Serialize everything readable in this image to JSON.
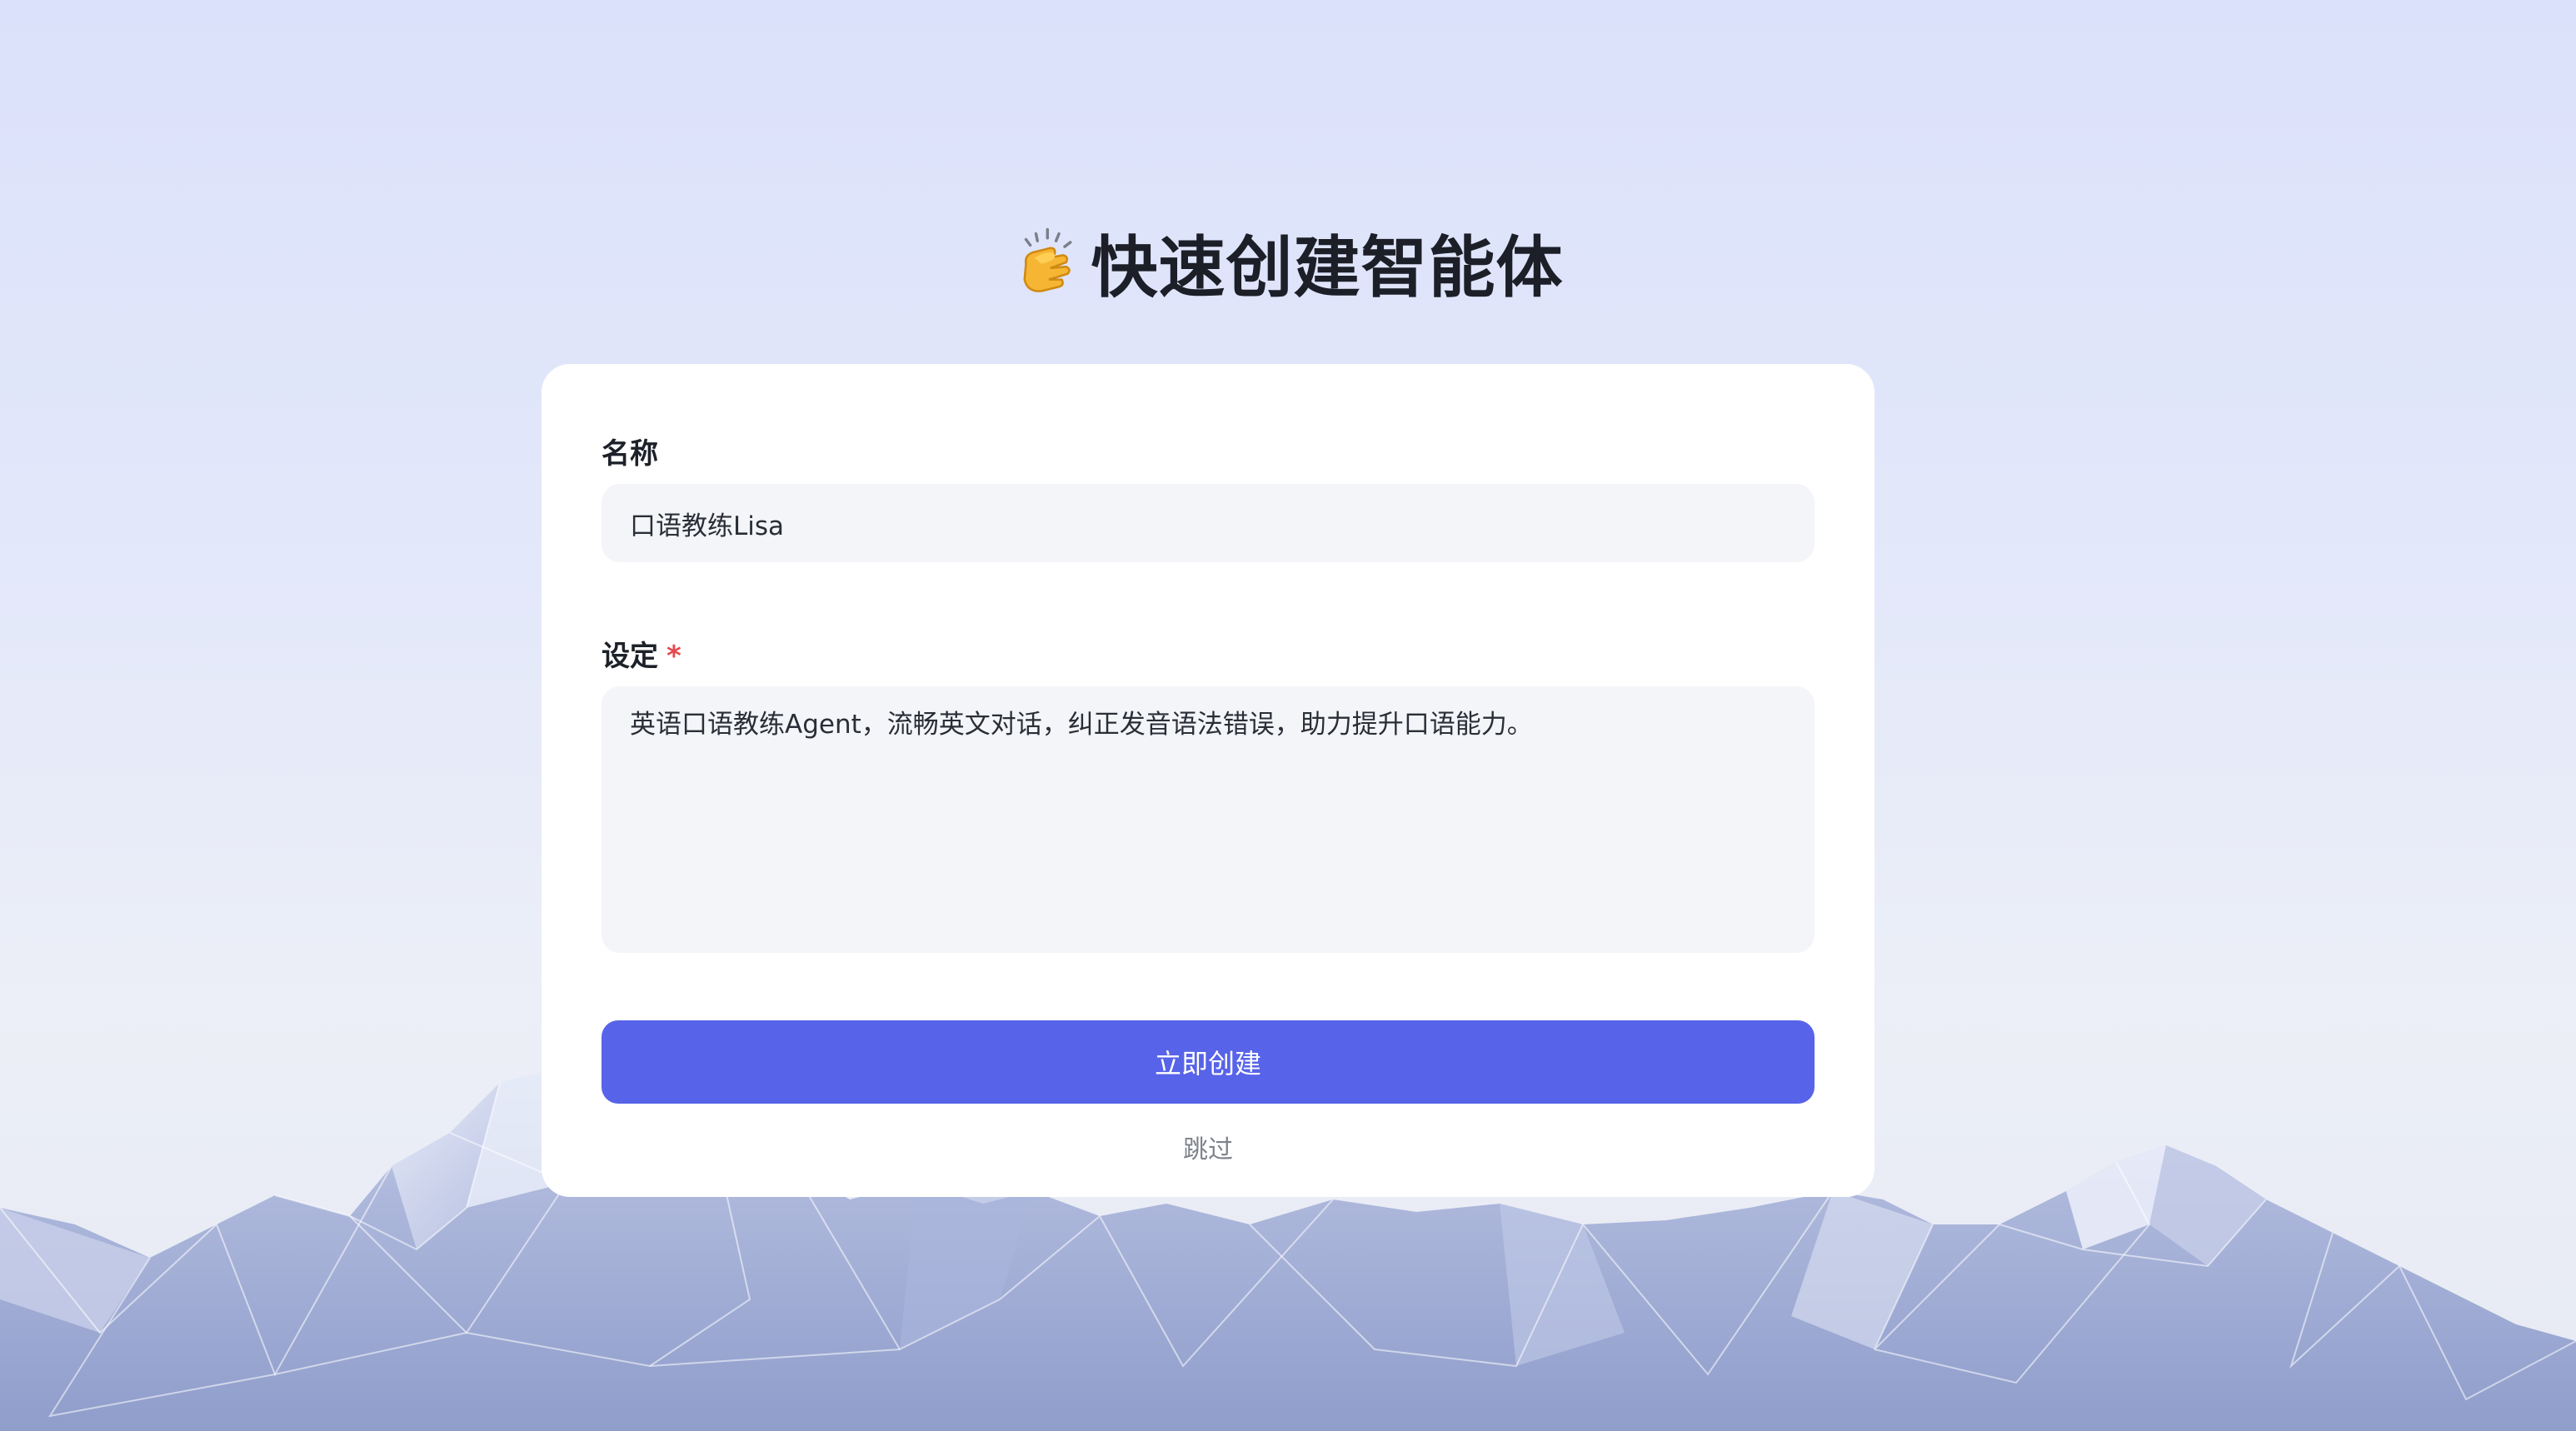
{
  "header": {
    "emoji_icon": "clapping-hands-icon",
    "title": "快速创建智能体"
  },
  "form": {
    "name_label": "名称",
    "name_value": "口语教练Lisa",
    "setting_label": "设定",
    "required_mark": "*",
    "setting_value": "英语口语教练Agent，流畅英文对话，纠正发音语法错误，助力提升口语能力。",
    "create_button_label": "立即创建",
    "skip_label": "跳过"
  },
  "colors": {
    "accent": "#5763e8",
    "required": "#e5484d",
    "input_background": "#f4f5f9"
  }
}
